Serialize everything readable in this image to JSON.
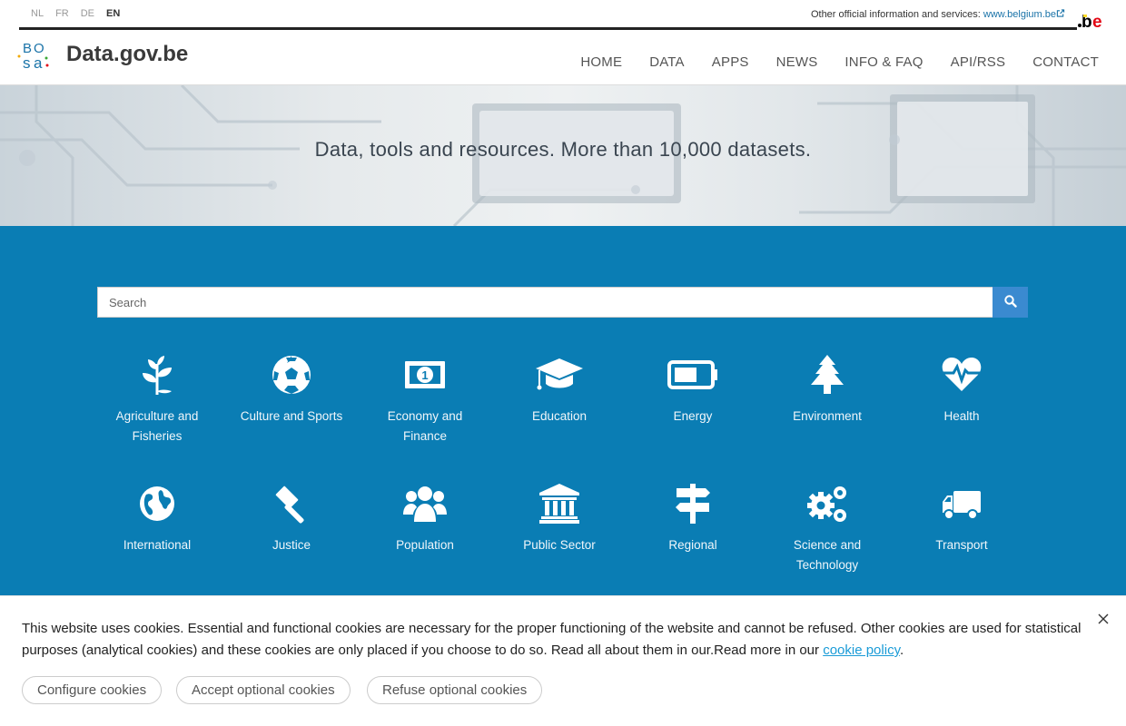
{
  "languages": [
    {
      "code": "NL",
      "active": false
    },
    {
      "code": "FR",
      "active": false
    },
    {
      "code": "DE",
      "active": false
    },
    {
      "code": "EN",
      "active": true
    }
  ],
  "official": {
    "label": "Other official information and services:",
    "link": "www.belgium.be",
    "ext_marker": "(link is external)"
  },
  "be_logo_text": ".be",
  "bosa_logo_text": "BOSA",
  "site_title": "Data.gov.be",
  "nav": [
    "HOME",
    "DATA",
    "APPS",
    "NEWS",
    "INFO & FAQ",
    "API/RSS",
    "CONTACT"
  ],
  "hero": {
    "tagline": "Data, tools and resources. More than 10,000 datasets."
  },
  "search": {
    "placeholder": "Search",
    "value": ""
  },
  "categories": [
    {
      "label": "Agriculture and Fisheries",
      "icon": "leaf-icon"
    },
    {
      "label": "Culture and Sports",
      "icon": "soccer-ball-icon"
    },
    {
      "label": "Economy and Finance",
      "icon": "banknote-icon"
    },
    {
      "label": "Education",
      "icon": "graduation-cap-icon"
    },
    {
      "label": "Energy",
      "icon": "battery-icon"
    },
    {
      "label": "Environment",
      "icon": "tree-icon"
    },
    {
      "label": "Health",
      "icon": "heartbeat-icon"
    },
    {
      "label": "International",
      "icon": "globe-icon"
    },
    {
      "label": "Justice",
      "icon": "gavel-icon"
    },
    {
      "label": "Population",
      "icon": "users-icon"
    },
    {
      "label": "Public Sector",
      "icon": "institution-icon"
    },
    {
      "label": "Regional",
      "icon": "signpost-icon"
    },
    {
      "label": "Science and Technology",
      "icon": "gears-icon"
    },
    {
      "label": "Transport",
      "icon": "truck-icon"
    }
  ],
  "cookie": {
    "text": "This website uses cookies. Essential and functional cookies are necessary for the proper functioning of the website and cannot be refused. Other cookies are used for statistical purposes (analytical cookies) and these cookies are only placed if you choose to do so. Read all about them in our.Read more in our ",
    "policy_link": "cookie policy",
    "period": ".",
    "buttons": [
      "Configure cookies",
      "Accept optional cookies",
      "Refuse optional cookies"
    ]
  },
  "colors": {
    "primary_blue": "#0a7db4",
    "search_button": "#3a8ad0",
    "link": "#1a9bd7",
    "belgium_red": "#e30613",
    "belgium_yellow": "#fdda24"
  }
}
